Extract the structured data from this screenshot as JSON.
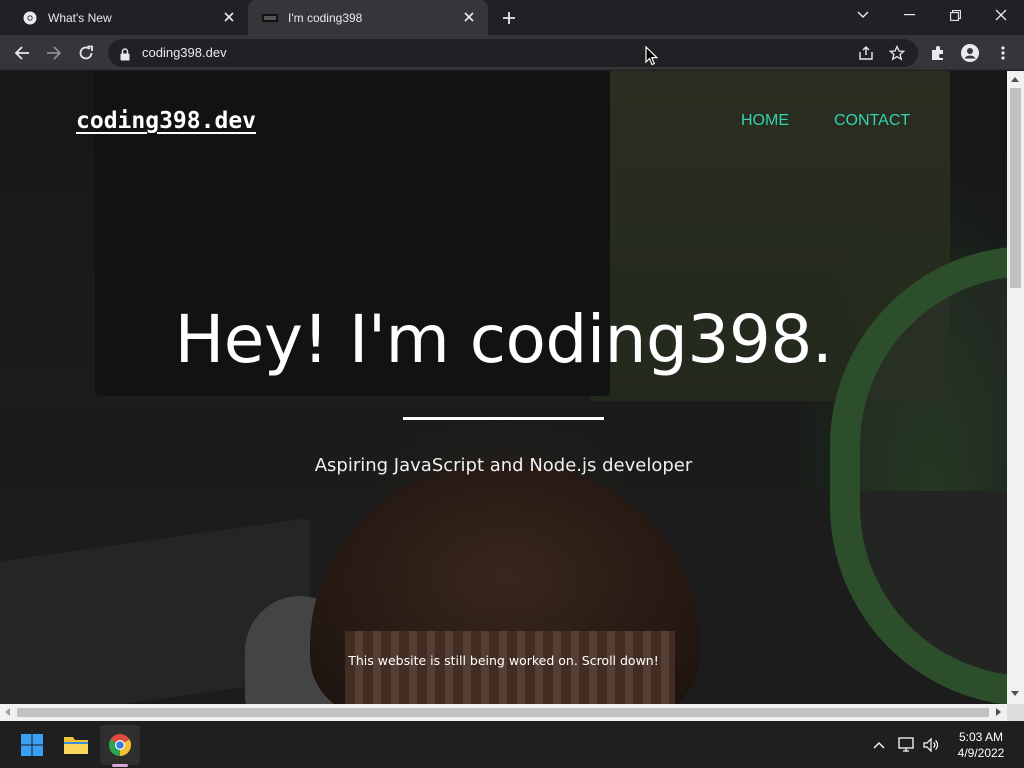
{
  "browser": {
    "tabs": [
      {
        "title": "What's New",
        "favicon": "chrome-icon",
        "active": false
      },
      {
        "title": "I'm coding398",
        "favicon": "site-favicon",
        "active": true
      }
    ],
    "address": "coding398.dev"
  },
  "site": {
    "logo": "coding398.dev",
    "nav": [
      {
        "label": "HOME"
      },
      {
        "label": "CONTACT"
      }
    ],
    "hero_title": "Hey! I'm coding398.",
    "hero_subtitle": "Aspiring JavaScript and Node.js developer",
    "hero_note": "This website is still being worked on. Scroll down!",
    "accent_color": "#35d0b0"
  },
  "taskbar": {
    "clock_time": "5:03 AM",
    "clock_date": "4/9/2022"
  }
}
